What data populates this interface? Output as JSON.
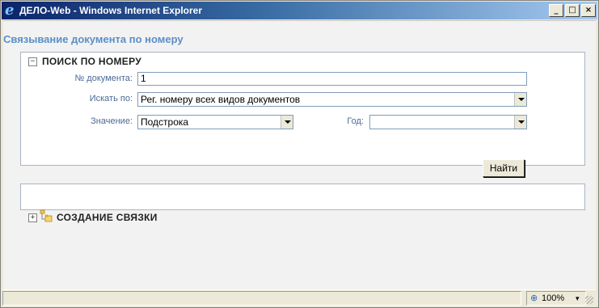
{
  "window": {
    "title": "ДЕЛО-Web - Windows Internet Explorer",
    "icon": "ie-icon",
    "minimize_glyph": "_",
    "maximize_glyph": "□",
    "close_glyph": "×"
  },
  "page": {
    "title": "Связывание документа по номеру"
  },
  "search_panel": {
    "toggle_glyph": "−",
    "heading": "ПОИСК ПО НОМЕРУ",
    "doc_number_label": "№ документа:",
    "doc_number_value": "1",
    "search_by_label": "Искать по:",
    "search_by_value": "Рег. номеру всех видов документов",
    "match_label": "Значение:",
    "match_value": "Подстрока",
    "year_label": "Год:",
    "year_value": "",
    "find_button": "Найти"
  },
  "link_panel": {
    "toggle_glyph": "+",
    "icon": "folder-tree-icon",
    "heading": "СОЗДАНИЕ СВЯЗКИ"
  },
  "statusbar": {
    "zoom_icon_glyph": "⊕",
    "zoom": "100%",
    "zoom_arrow": "▾"
  },
  "colors": {
    "title_gradient_start": "#0a246a",
    "page_title": "#5b8fc7",
    "label": "#4a6a96",
    "panel_border": "#a8b4c4"
  }
}
